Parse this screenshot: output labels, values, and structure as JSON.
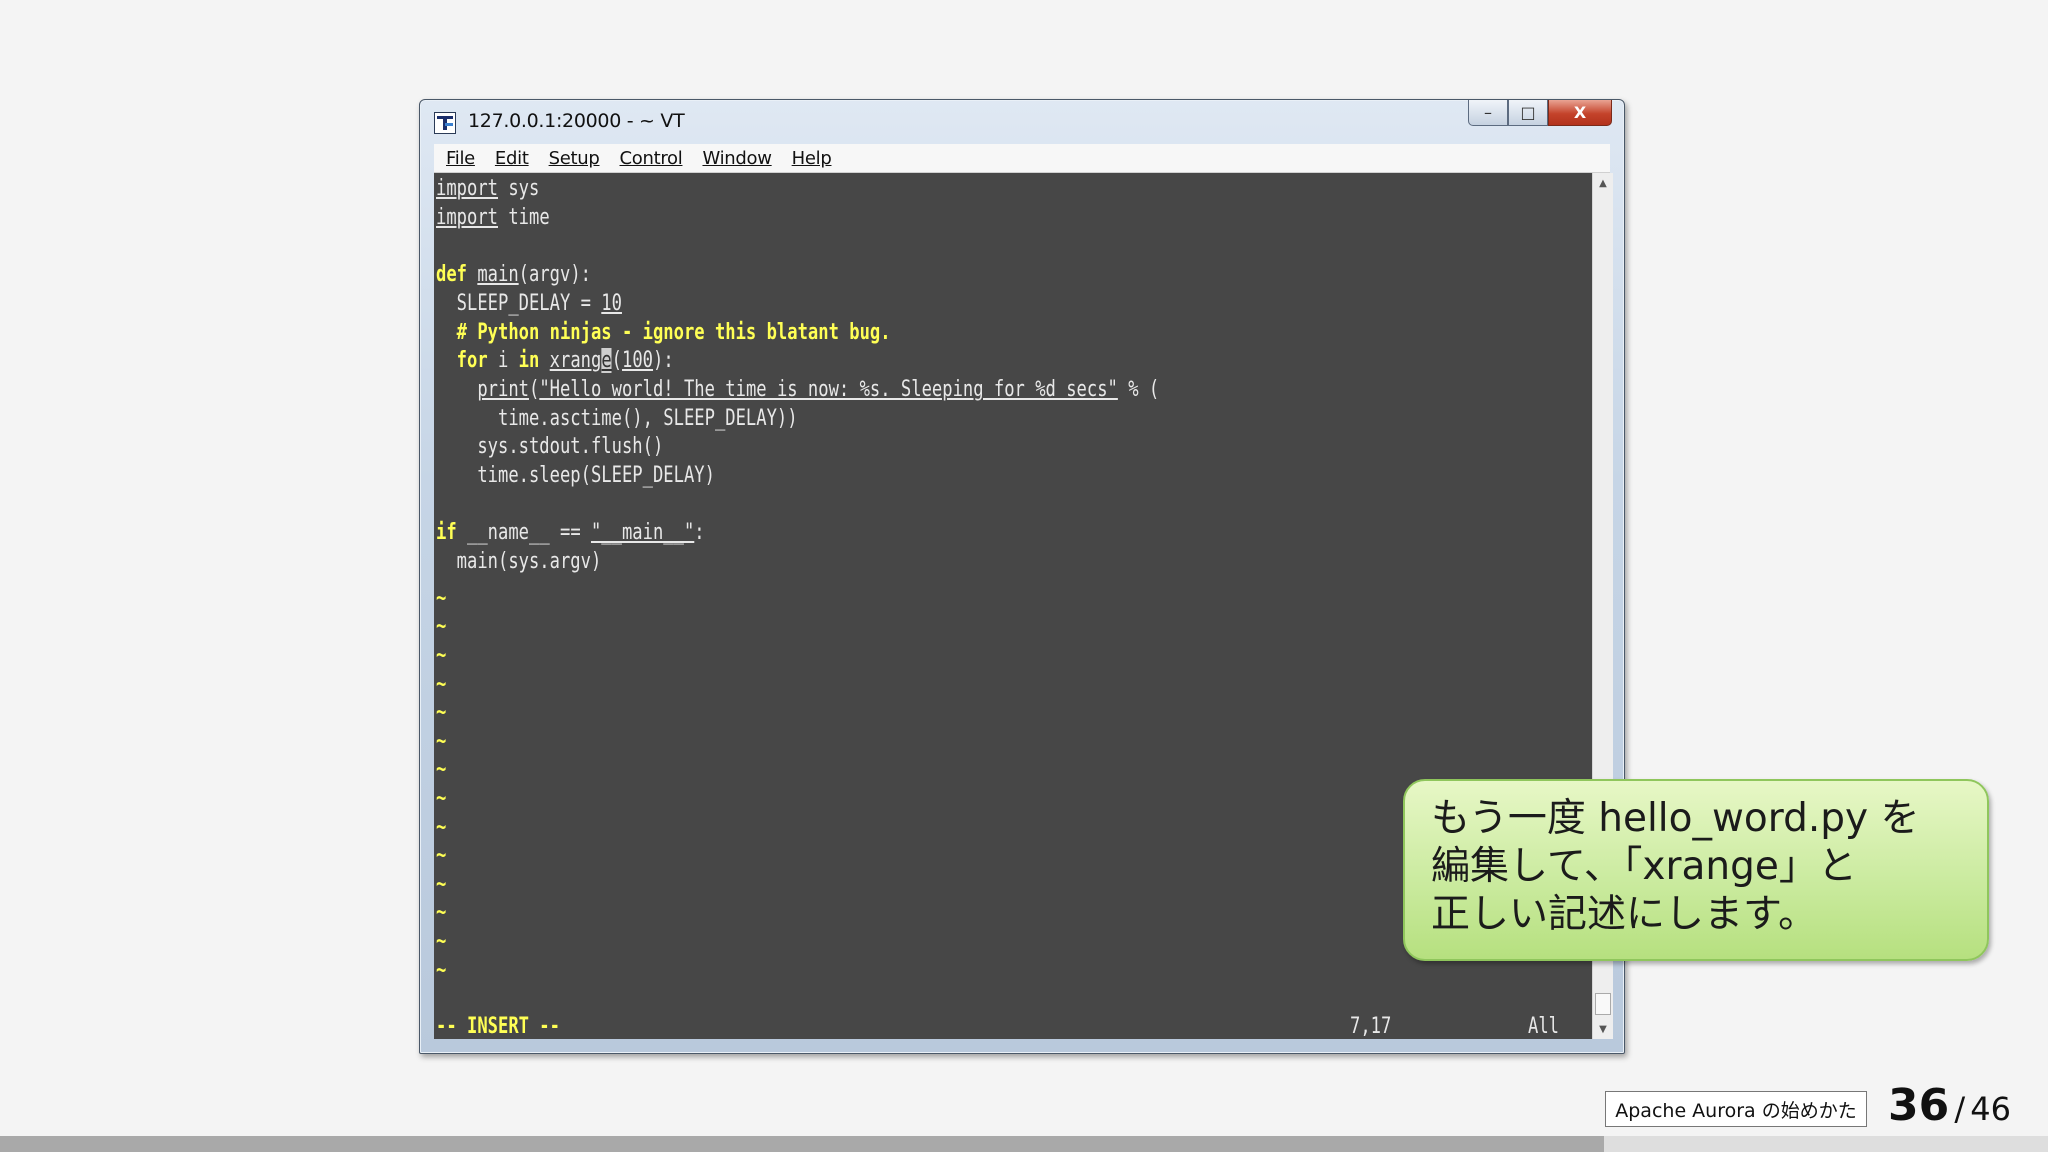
{
  "window": {
    "title": "127.0.0.1:20000 - ~ VT",
    "controls": {
      "minimize": "–",
      "maximize": "□",
      "close": "X"
    }
  },
  "menu": [
    "File",
    "Edit",
    "Setup",
    "Control",
    "Window",
    "Help"
  ],
  "editor": {
    "code": [
      "import sys",
      "import time",
      "",
      "def main(argv):",
      "  SLEEP_DELAY = 10",
      "  # Python ninjas - ignore this blatant bug.",
      "  for i in xrange(100):",
      "    print(\"Hello world! The time is now: %s. Sleeping for %d secs\" % (",
      "      time.asctime(), SLEEP_DELAY))",
      "    sys.stdout.flush()",
      "    time.sleep(SLEEP_DELAY)",
      "",
      "if __name__ == \"__main__\":",
      "  main(sys.argv)"
    ],
    "tilde_lines": 14,
    "mode": "-- INSERT --",
    "cursor_position": "7,17",
    "scroll_status": "All"
  },
  "callout": {
    "lines": [
      "もう一度 hello_word.py を",
      "編集して、「xrange」と",
      "正しい記述にします。"
    ]
  },
  "footer": {
    "label": "Apache Aurora の始めかた",
    "current_page": "36",
    "separator": "/",
    "total_pages": "46",
    "progress": 0.783
  }
}
